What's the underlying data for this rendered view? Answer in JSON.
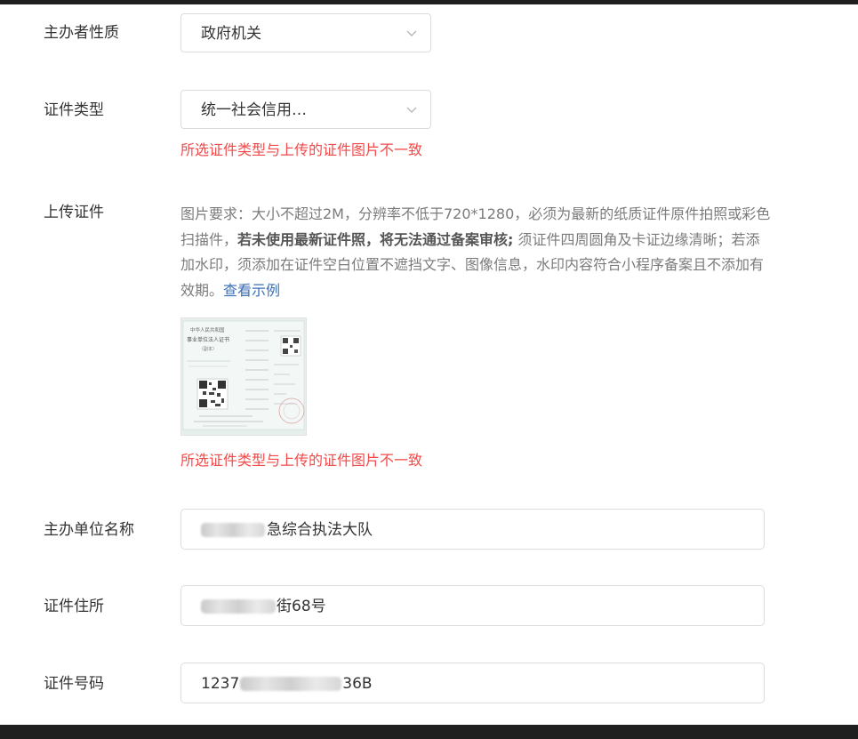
{
  "fields": {
    "organizer_type": {
      "label": "主办者性质",
      "value": "政府机关"
    },
    "cert_type": {
      "label": "证件类型",
      "value": "统一社会信用…",
      "error": "所选证件类型与上传的证件图片不一致"
    },
    "upload_cert": {
      "label": "上传证件",
      "desc_part1": "图片要求：大小不超过2M，分辨率不低于720*1280，必须为最新的纸质证件原件拍照或彩色扫描件，",
      "desc_bold": "若未使用最新证件照，将无法通过备案审核;",
      "desc_part2": " 须证件四周圆角及卡证边缘清晰；若添加水印，须添加在证件空白位置不遮挡文字、图像信息，水印内容符合小程序备案且不添加有效期。",
      "desc_link": "查看示例",
      "error": "所选证件类型与上传的证件图片不一致",
      "image": {
        "header_line1": "中华人民共和国",
        "header_line2": "事业单位法人证书",
        "header_line3": "（副本）"
      }
    },
    "org_name": {
      "label": "主办单位名称",
      "value": "急综合执法大队"
    },
    "cert_address": {
      "label": "证件住所",
      "value": "街68号"
    },
    "cert_number": {
      "label": "证件号码",
      "value_prefix": "1237",
      "value_suffix": "36B"
    }
  },
  "icons": {
    "dropdown": "chevron-down-icon"
  },
  "colors": {
    "error": "#f04a4a",
    "link": "#3b6fb6",
    "border": "#dcdcdc"
  }
}
